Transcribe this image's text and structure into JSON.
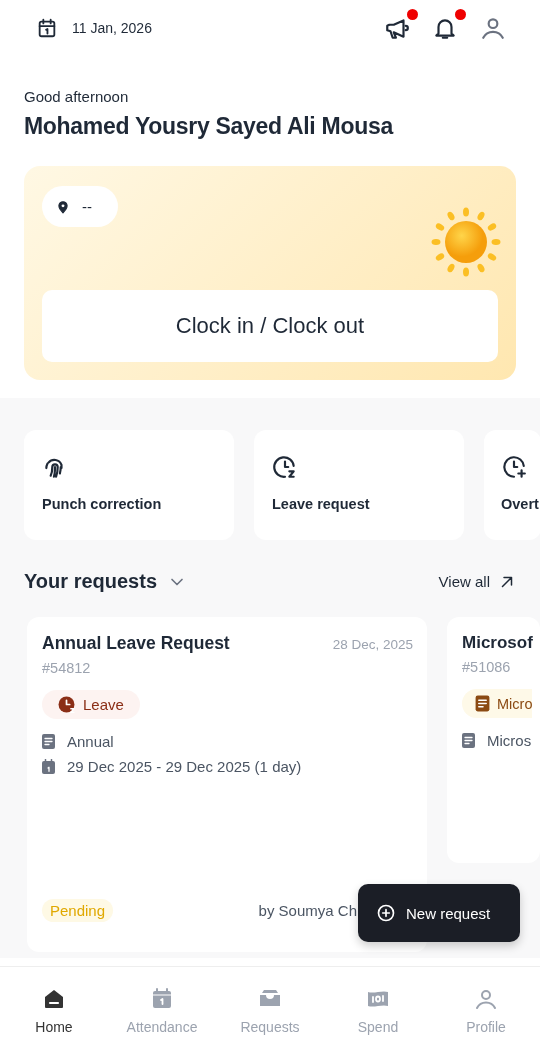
{
  "header": {
    "date": "11 Jan, 2026",
    "announcements_unread": true,
    "notifications_unread": true
  },
  "greeting": "Good afternoon",
  "user_name": "Mohamed Yousry Sayed Ali Mousa",
  "clock_card": {
    "location": "--",
    "button": "Clock in / Clock out"
  },
  "quick_actions": [
    {
      "kind": "fingerprint",
      "label": "Punch correction"
    },
    {
      "kind": "leave",
      "label": "Leave request"
    },
    {
      "kind": "overtime",
      "label": "Overt"
    }
  ],
  "requests_section": {
    "title": "Your requests",
    "view_all": "View all"
  },
  "requests": [
    {
      "title": "Annual Leave Request",
      "date": "28 Dec, 2025",
      "number": "#54812",
      "tag": {
        "kind": "leave",
        "label": "Leave"
      },
      "details": [
        {
          "kind": "doc",
          "text": "Annual"
        },
        {
          "kind": "calendar",
          "text": "29 Dec 2025 - 29 Dec 2025 (1 day)"
        }
      ],
      "status": "Pending",
      "by": "by Soumya Ch"
    },
    {
      "title": "Microsof",
      "number": "#51086",
      "tag": {
        "kind": "expense",
        "label": "Micro"
      },
      "details": [
        {
          "kind": "doc",
          "text": "Micros"
        }
      ]
    }
  ],
  "fab": {
    "label": "New request"
  },
  "nav": [
    {
      "kind": "home",
      "label": "Home",
      "selected": true
    },
    {
      "kind": "attendance",
      "label": "Attendance",
      "selected": false
    },
    {
      "kind": "requests",
      "label": "Requests",
      "selected": false
    },
    {
      "kind": "spend",
      "label": "Spend",
      "selected": false
    },
    {
      "kind": "profile",
      "label": "Profile",
      "selected": false
    }
  ]
}
